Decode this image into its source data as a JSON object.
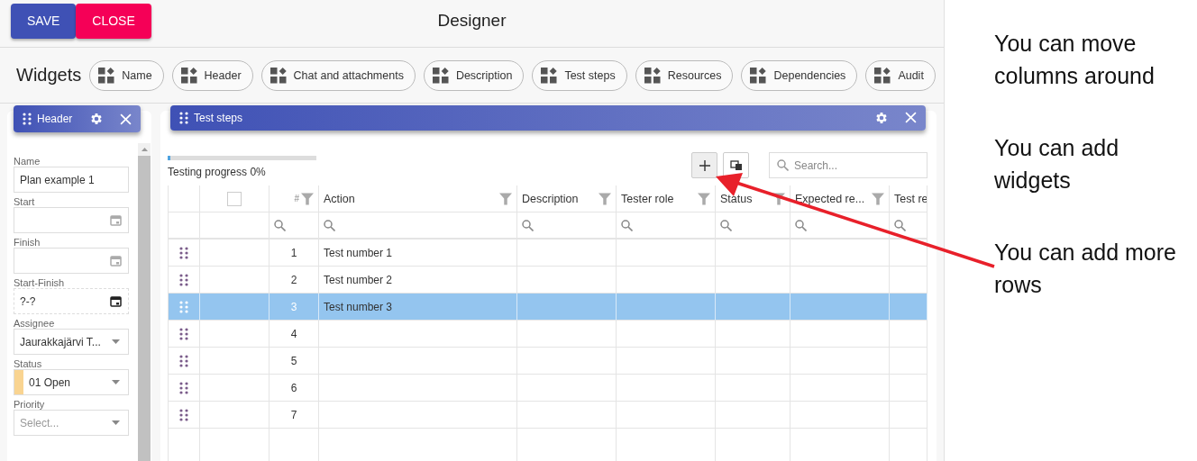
{
  "top_bar": {
    "buttons": [
      {
        "label": "SAVE",
        "kind": "primary"
      },
      {
        "label": "CLOSE",
        "kind": "danger"
      }
    ],
    "title": "Designer"
  },
  "widgets": {
    "label": "Widgets",
    "items": [
      "Name",
      "Header",
      "Chat and attachments",
      "Description",
      "Test steps",
      "Resources",
      "Dependencies",
      "Audit"
    ]
  },
  "header_panel": {
    "title": "Header",
    "fields": [
      {
        "label": "Name",
        "kind": "text",
        "value": "Plan example 1"
      },
      {
        "label": "Start",
        "kind": "date"
      },
      {
        "label": "Finish",
        "kind": "date"
      },
      {
        "label": "Start-Finish",
        "kind": "range",
        "value": "?-?"
      },
      {
        "label": "Assignee",
        "kind": "select",
        "value": "Jaurakkajärvi T..."
      },
      {
        "label": "Status",
        "kind": "select",
        "value": "01 Open",
        "color": "#f9d491"
      },
      {
        "label": "Priority",
        "kind": "select",
        "placeholder": "Select..."
      }
    ]
  },
  "test_steps": {
    "title": "Test steps",
    "progress": {
      "label": "Testing progress 0%",
      "level": 0
    },
    "search": {
      "placeholder": "Search..."
    },
    "select_all": {
      "checked": false
    },
    "columns": [
      {
        "label": "#",
        "filter": true
      },
      {
        "label": "Action",
        "filter": true
      },
      {
        "label": "Description",
        "filter": true
      },
      {
        "label": "Tester role",
        "filter": true
      },
      {
        "label": "Status",
        "filter": true
      },
      {
        "label": "Expected re...",
        "filter": true
      },
      {
        "label": "Test re"
      }
    ],
    "rows": [
      {
        "number": "1",
        "action": "Test number 1",
        "selected": false
      },
      {
        "number": "2",
        "action": "Test number 2",
        "selected": false
      },
      {
        "number": "3",
        "action": "Test number 3",
        "selected": true
      },
      {
        "number": "4",
        "selected": false
      },
      {
        "number": "5",
        "selected": false
      },
      {
        "number": "6",
        "selected": false
      },
      {
        "number": "7",
        "selected": false
      }
    ]
  },
  "annotations": [
    "You can move columns around",
    "You can add widgets",
    "You can add more rows"
  ]
}
